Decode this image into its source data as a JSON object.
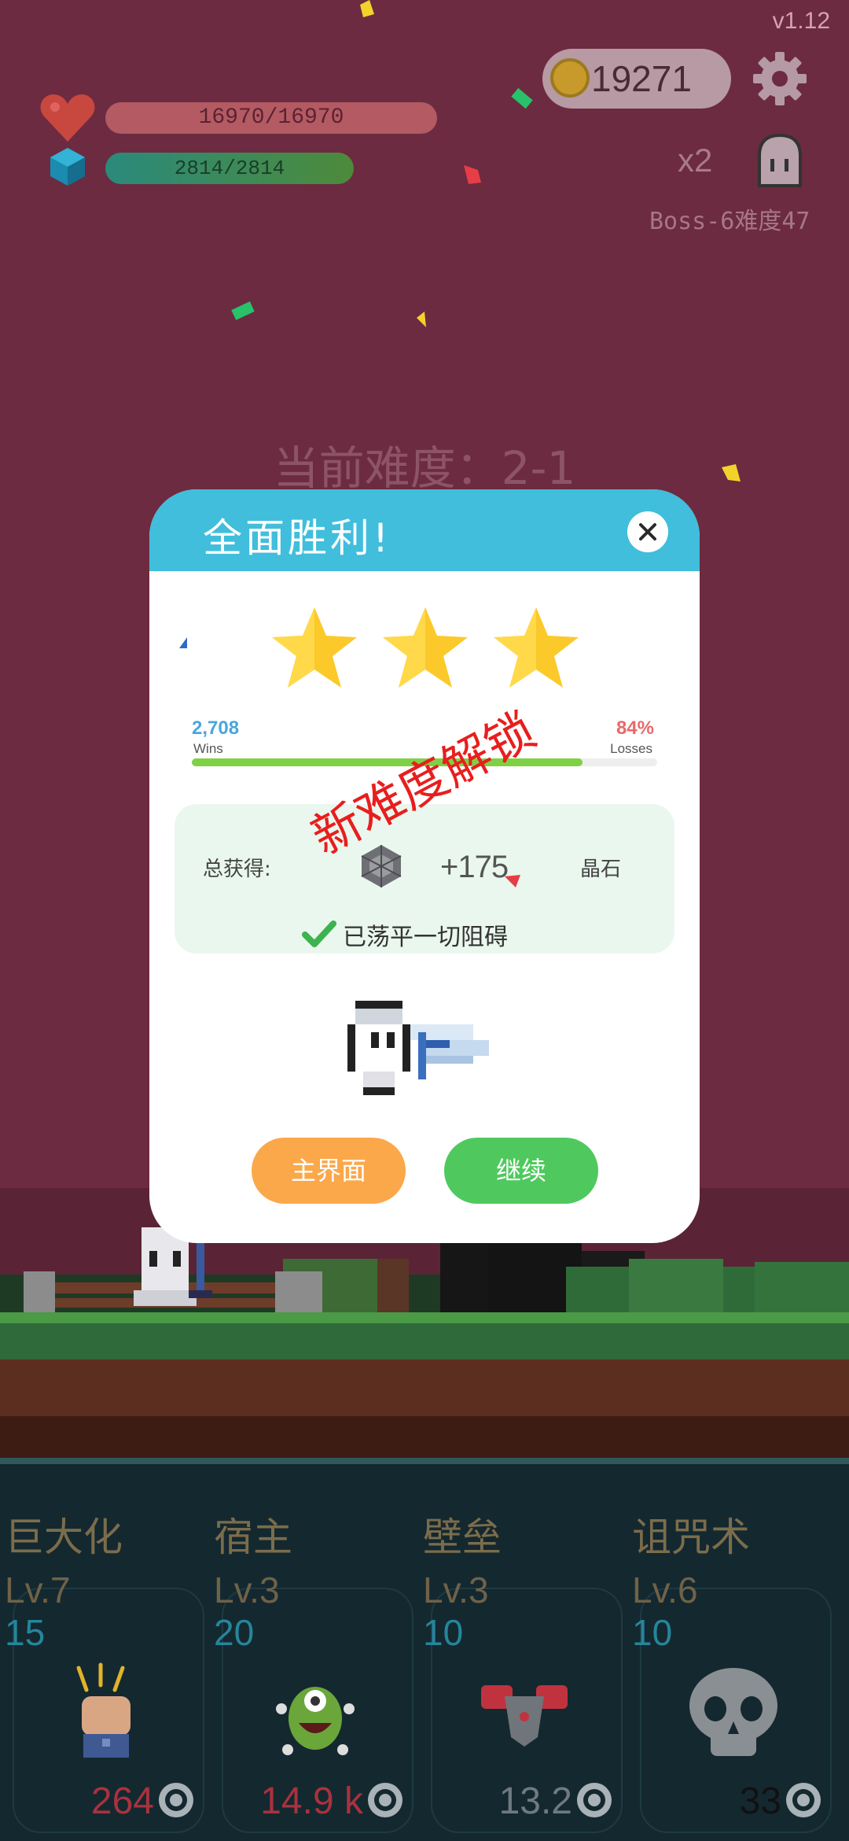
{
  "hud": {
    "version": "v1.12",
    "hp": "16970/16970",
    "mp": "2814/2814",
    "coins": "19271",
    "speed": "x2",
    "boss_info": "Boss-6难度47",
    "current_difficulty": "当前难度：2-1"
  },
  "modal": {
    "title": "全面胜利!",
    "stars_earned": 3,
    "wins_count": "2,708",
    "wins_label": "Wins",
    "losses_pct": "84%",
    "losses_label": "Losses",
    "win_fraction": 0.84,
    "stamp": "新难度解锁",
    "reward_label": "总获得:",
    "reward_amount": "+175",
    "reward_unit": "晶石",
    "achievement": "已荡平一切阻碍",
    "main_menu_label": "主界面",
    "continue_label": "继续"
  },
  "skills": [
    {
      "name": "巨大化",
      "level": "Lv.7",
      "cost": "15",
      "value": "264",
      "value_color": "#a8323e",
      "icon": "fist-icon"
    },
    {
      "name": "宿主",
      "level": "Lv.3",
      "cost": "20",
      "value": "14.9 k",
      "value_color": "#a8323e",
      "icon": "monster-icon"
    },
    {
      "name": "壁垒",
      "level": "Lv.3",
      "cost": "10",
      "value": "13.2",
      "value_color": "#6f7a80",
      "icon": "armor-icon"
    },
    {
      "name": "诅咒术",
      "level": "Lv.6",
      "cost": "10",
      "value": "33",
      "value_color": "#111111",
      "icon": "skull-icon"
    }
  ],
  "colors": {
    "header": "#40bedc",
    "main_menu": "#fba84a",
    "continue": "#4fc95e",
    "stamp": "#e81e1e"
  }
}
